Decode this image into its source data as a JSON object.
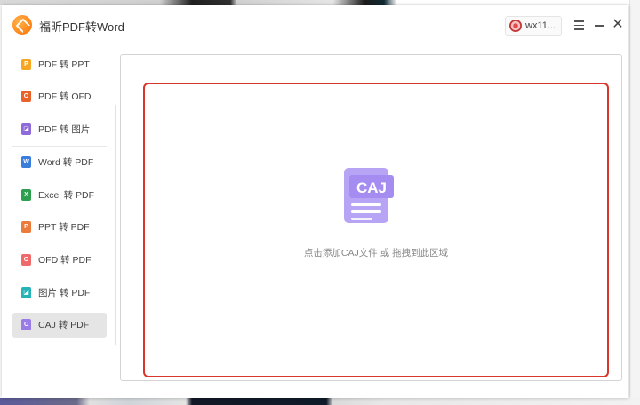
{
  "app": {
    "title": "福昕PDF转Word",
    "user_name": "wx11..."
  },
  "sidebar": {
    "items": [
      {
        "label": "PDF 转 PPT",
        "icon": "pdf-to-ppt-icon",
        "color": "#f5a623",
        "glyph": "P",
        "active": false
      },
      {
        "label": "PDF 转 OFD",
        "icon": "pdf-to-ofd-icon",
        "color": "#e8622c",
        "glyph": "O",
        "active": false
      },
      {
        "label": "PDF 转 图片",
        "icon": "pdf-to-image-icon",
        "color": "#8e6bd8",
        "glyph": "◪",
        "active": false
      },
      {
        "label": "Word 转 PDF",
        "icon": "word-to-pdf-icon",
        "color": "#3b7ddd",
        "glyph": "W",
        "active": false
      },
      {
        "label": "Excel 转 PDF",
        "icon": "excel-to-pdf-icon",
        "color": "#2e9e4f",
        "glyph": "X",
        "active": false
      },
      {
        "label": "PPT 转 PDF",
        "icon": "ppt-to-pdf-icon",
        "color": "#ec7a3b",
        "glyph": "P",
        "active": false
      },
      {
        "label": "OFD 转 PDF",
        "icon": "ofd-to-pdf-icon",
        "color": "#ef6a6a",
        "glyph": "O",
        "active": false
      },
      {
        "label": "图片 转 PDF",
        "icon": "image-to-pdf-icon",
        "color": "#25b3b8",
        "glyph": "◪",
        "active": false
      },
      {
        "label": "CAJ 转 PDF",
        "icon": "caj-to-pdf-icon",
        "color": "#9b7ce6",
        "glyph": "C",
        "active": true
      }
    ]
  },
  "drop_zone": {
    "text": "点击添加CAJ文件 或 拖拽到此区域",
    "icon_label": "CAJ",
    "border_color": "#d9362b",
    "icon_color": "#a58cf0"
  }
}
